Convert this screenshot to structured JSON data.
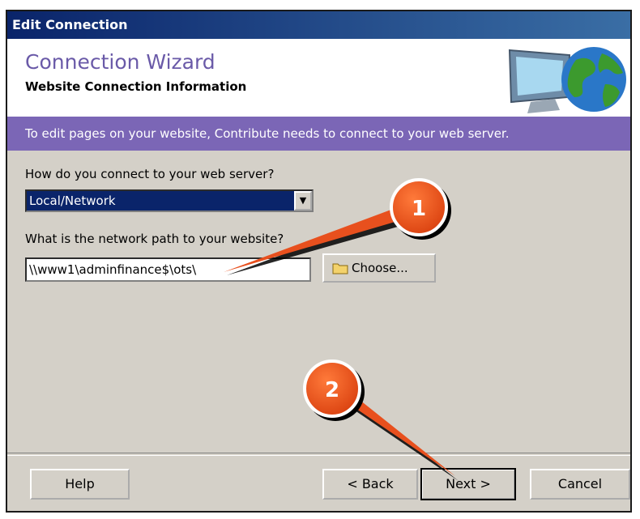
{
  "window": {
    "title": "Edit Connection"
  },
  "header": {
    "title": "Connection Wizard",
    "subtitle": "Website Connection Information"
  },
  "banner": {
    "text": "To edit pages on your website, Contribute needs to connect to your web server."
  },
  "form": {
    "connect_label": "How do you connect to your web server?",
    "connect_value": "Local/Network",
    "path_label": "What is the network path to your website?",
    "path_value": "\\\\www1\\adminfinance$\\ots\\",
    "choose_label": "Choose..."
  },
  "buttons": {
    "help": "Help",
    "back": "< Back",
    "next": "Next >",
    "cancel": "Cancel"
  },
  "callouts": [
    "1",
    "2"
  ],
  "colors": {
    "accent": "#7b66b6",
    "title_text": "#6a5aa8",
    "callout": "#e8501e",
    "titlebar": "#0a246a"
  },
  "icons": {
    "header_image": "globe-monitor-icon",
    "choose": "folder-icon",
    "dropdown": "chevron-down-icon"
  }
}
